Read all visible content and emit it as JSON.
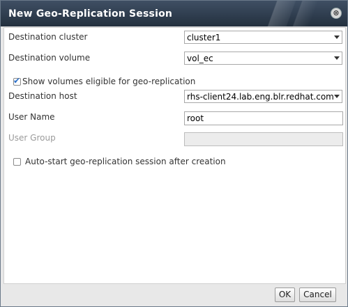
{
  "dialog": {
    "title": "New Geo-Replication Session",
    "close_glyph": "⊗"
  },
  "form": {
    "destination_cluster": {
      "label": "Destination cluster",
      "value": "cluster1"
    },
    "destination_volume": {
      "label": "Destination volume",
      "value": "vol_ec"
    },
    "show_eligible": {
      "label": "Show volumes eligible for geo-replication",
      "checked": true
    },
    "destination_host": {
      "label": "Destination host",
      "value": "rhs-client24.lab.eng.blr.redhat.com"
    },
    "user_name": {
      "label": "User Name",
      "value": "root"
    },
    "user_group": {
      "label": "User Group",
      "value": ""
    },
    "auto_start": {
      "label": "Auto-start geo-replication session after creation",
      "checked": false
    }
  },
  "buttons": {
    "ok": "OK",
    "cancel": "Cancel"
  },
  "icons": {
    "close": "close-icon",
    "check": "check-icon",
    "dropdown": "chevron-down-icon"
  },
  "colors": {
    "titlebar": "#2f3d4f",
    "accent": "#2a6fc9"
  }
}
